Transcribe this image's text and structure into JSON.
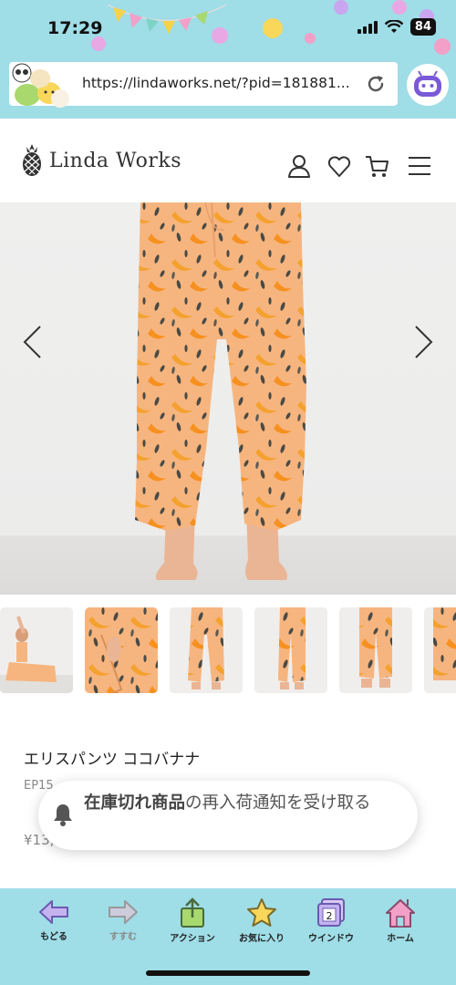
{
  "status_bar": {
    "time": "17:29",
    "battery": "84"
  },
  "browser": {
    "url": "https://lindaworks.net/?pid=181881..."
  },
  "site": {
    "brand": "Linda Works"
  },
  "product": {
    "name": "エリスパンツ ココバナナ",
    "code": "EP15",
    "price": "¥13,"
  },
  "notification": {
    "bold": "在庫切れ商品",
    "text": "の再入荷通知を受け取る"
  },
  "toolbar": {
    "back": "もどる",
    "forward": "すすむ",
    "action": "アクション",
    "favorites": "お気に入り",
    "window": "ウインドウ",
    "window_count": "2",
    "home": "ホーム"
  },
  "colors": {
    "chrome": "#9fdde7",
    "pants": "#f6b57f",
    "accent": "#7a5ad8"
  }
}
